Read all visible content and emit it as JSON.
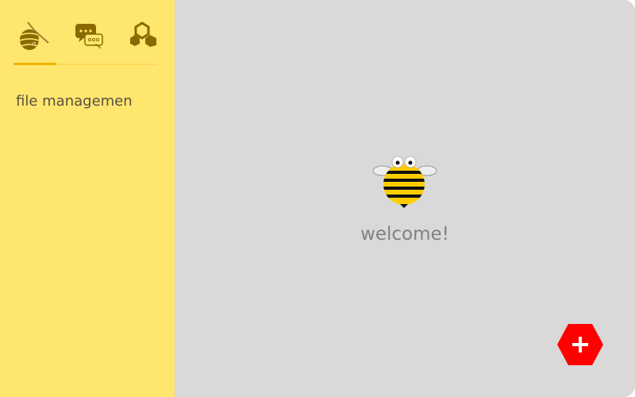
{
  "sidebar": {
    "tabs": [
      {
        "icon": "beehive-icon",
        "active": true
      },
      {
        "icon": "chat-bubbles-icon",
        "active": false
      },
      {
        "icon": "honeycomb-icon",
        "active": false
      }
    ],
    "files": [
      {
        "label": "file managemen"
      }
    ]
  },
  "main": {
    "mascot": "bee-icon",
    "welcome_text": "welcome!",
    "add_button_icon": "plus-icon"
  },
  "colors": {
    "sidebar_bg": "#ffe66e",
    "main_bg": "#d9d9d9",
    "accent": "#f2b400",
    "icon": "#8a6a00",
    "add_button": "#ff0000"
  }
}
